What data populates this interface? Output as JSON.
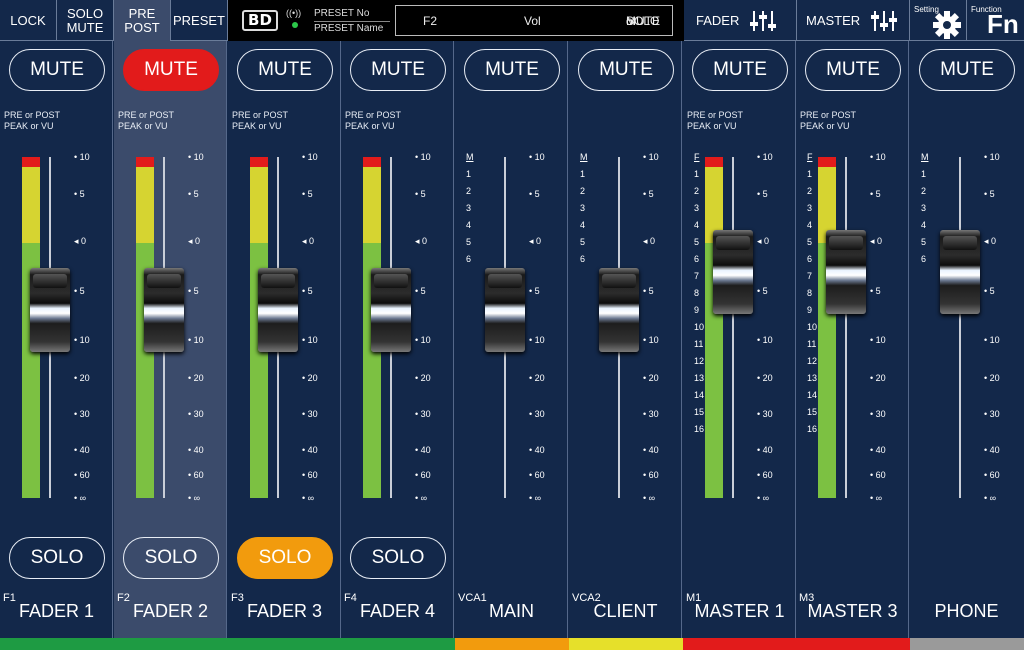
{
  "toolbar": {
    "lock": "LOCK",
    "solo_mute_1": "SOLO",
    "solo_mute_2": "MUTE",
    "pre_post_1": "PRE",
    "pre_post_2": "POST",
    "preset": "PRESET",
    "logo": "BD",
    "preset_no": "PRESET No",
    "preset_name": "PRESET Name",
    "display": {
      "channel": "F2",
      "param": "Vol",
      "solo_1": "SOLO",
      "solo_2": "or",
      "solo_3": "MUTE"
    },
    "fader": "FADER",
    "master": "MASTER",
    "setting": "Setting",
    "function": "Function",
    "fn": "Fn"
  },
  "pre_post_line1": "PRE or POST",
  "pre_post_line2": "PEAK or VU",
  "mute_label": "MUTE",
  "solo_label": "SOLO",
  "right_scale": [
    "10",
    "5",
    "0",
    "5",
    "10",
    "20",
    "30",
    "40",
    "60",
    "∞"
  ],
  "channels": [
    {
      "code": "F1",
      "name": "FADER 1",
      "mute_on": false,
      "solo": true,
      "solo_on": false,
      "selected": false,
      "meter": true,
      "fader_level": 0.45
    },
    {
      "code": "F2",
      "name": "FADER 2",
      "mute_on": true,
      "solo": true,
      "solo_on": false,
      "selected": true,
      "meter": true,
      "fader_level": 0.45
    },
    {
      "code": "F3",
      "name": "FADER 3",
      "mute_on": false,
      "solo": true,
      "solo_on": true,
      "selected": false,
      "meter": true,
      "fader_level": 0.45
    },
    {
      "code": "F4",
      "name": "FADER 4",
      "mute_on": false,
      "solo": true,
      "solo_on": false,
      "selected": false,
      "meter": true,
      "fader_level": 0.45
    },
    {
      "code": "VCA1",
      "name": "MAIN",
      "mute_on": false,
      "solo": false,
      "selected": false,
      "meter": false,
      "fader_level": 0.45,
      "left_scale": [
        "M",
        "1",
        "2",
        "3",
        "4",
        "5",
        "6"
      ]
    },
    {
      "code": "VCA2",
      "name": "CLIENT",
      "mute_on": false,
      "solo": false,
      "selected": false,
      "meter": false,
      "fader_level": 0.45,
      "left_scale": [
        "M",
        "1",
        "2",
        "3",
        "4",
        "5",
        "6"
      ]
    },
    {
      "code": "M1",
      "name": "MASTER 1",
      "mute_on": false,
      "solo": false,
      "selected": false,
      "meter": true,
      "fader_level": 0.6,
      "left_scale": [
        "F",
        "1",
        "2",
        "3",
        "4",
        "5",
        "6",
        "7",
        "8",
        "9",
        "10",
        "11",
        "12",
        "13",
        "14",
        "15",
        "16"
      ]
    },
    {
      "code": "M3",
      "name": "MASTER 3",
      "mute_on": false,
      "solo": false,
      "selected": false,
      "meter": true,
      "fader_level": 0.6,
      "left_scale": [
        "F",
        "1",
        "2",
        "3",
        "4",
        "5",
        "6",
        "7",
        "8",
        "9",
        "10",
        "11",
        "12",
        "13",
        "14",
        "15",
        "16"
      ]
    },
    {
      "code": "",
      "name": "PHONE",
      "mute_on": false,
      "solo": false,
      "selected": false,
      "meter": false,
      "fader_level": 0.6,
      "left_scale": [
        "M",
        "1",
        "2",
        "3",
        "4",
        "5",
        "6"
      ]
    }
  ],
  "colors": {
    "bg": "#13284a",
    "selected": "#3b4b6b",
    "mute_active": "#e21b1b",
    "solo_active": "#f29b0d",
    "meter_green": "#7cc142",
    "meter_yellow": "#d6d431",
    "meter_red": "#e21b1b"
  },
  "group_colors": [
    "#1e9b43",
    "#f29b0d",
    "#e6e02a",
    "#e21b1b",
    "#9a9a9a"
  ]
}
